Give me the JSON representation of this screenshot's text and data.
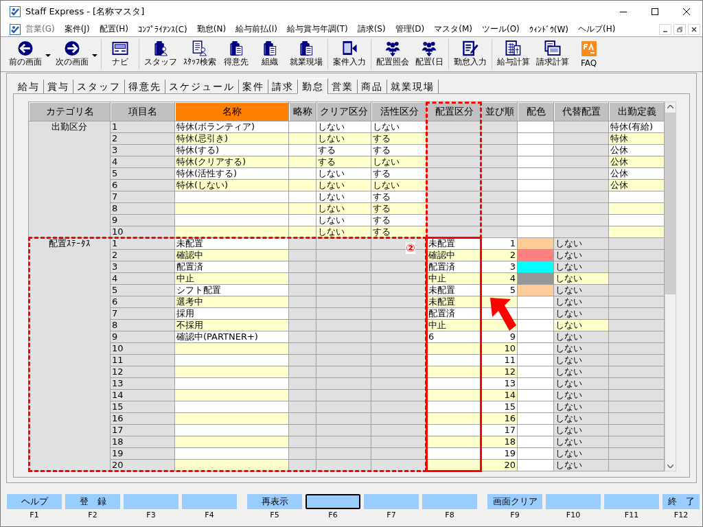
{
  "window": {
    "title": "Staff Express - [名称マスタ]"
  },
  "menu": [
    {
      "label": "営業(G)",
      "disabled": true
    },
    {
      "label": "案件(J)",
      "disabled": false
    },
    {
      "label": "配置(H)",
      "disabled": false
    },
    {
      "label": "ｺﾝﾌﾟﾗｲｱﾝｽ(C)",
      "disabled": false
    },
    {
      "label": "勤怠(N)",
      "disabled": false
    },
    {
      "label": "給与前払(I)",
      "disabled": false
    },
    {
      "label": "給与賞与年調(T)",
      "disabled": false
    },
    {
      "label": "請求(S)",
      "disabled": false
    },
    {
      "label": "管理(D)",
      "disabled": false
    },
    {
      "label": "マスタ(M)",
      "disabled": false
    },
    {
      "label": "ツール(O)",
      "disabled": false
    },
    {
      "label": "ｳｨﾝﾄﾞｳ(W)",
      "disabled": false
    },
    {
      "label": "ヘルプ(H)",
      "disabled": false
    }
  ],
  "toolbar_groups": [
    {
      "items": [
        {
          "label": "前の画面",
          "kind": "back",
          "dropdown": true
        },
        {
          "label": "次の画面",
          "kind": "forward",
          "dropdown": true
        }
      ]
    },
    {
      "items": [
        {
          "label": "ナビ",
          "kind": "panel",
          "dropdown": false
        }
      ]
    },
    {
      "items": [
        {
          "label": "スタッフ",
          "kind": "binder-person",
          "dropdown": false
        },
        {
          "label": "ｽﾀｯﾌ検索",
          "kind": "document-person",
          "dropdown": false
        },
        {
          "label": "得意先",
          "kind": "binder-building",
          "dropdown": false
        },
        {
          "label": "組織",
          "kind": "binder-building",
          "dropdown": false
        },
        {
          "label": "就業現場",
          "kind": "binder-building",
          "dropdown": false
        }
      ]
    },
    {
      "items": [
        {
          "label": "案件入力",
          "kind": "document-arrow",
          "dropdown": false
        }
      ]
    },
    {
      "items": [
        {
          "label": "配置照会",
          "kind": "people",
          "dropdown": false
        },
        {
          "label": "配置(日",
          "kind": "people",
          "dropdown": false
        }
      ]
    },
    {
      "items": [
        {
          "label": "勤怠入力",
          "kind": "pen-document",
          "dropdown": false
        }
      ]
    },
    {
      "items": [
        {
          "label": "給与計算",
          "kind": "calculator",
          "dropdown": false
        },
        {
          "label": "請求計算",
          "kind": "screen",
          "dropdown": false
        },
        {
          "label": "FAQ",
          "kind": "faq",
          "dropdown": false
        }
      ]
    }
  ],
  "tabs": [
    {
      "label": "給与",
      "selected": false
    },
    {
      "label": "賞与",
      "selected": false
    },
    {
      "label": "スタッフ",
      "selected": false
    },
    {
      "label": "得意先",
      "selected": false
    },
    {
      "label": "スケジュール",
      "selected": false
    },
    {
      "label": "案件",
      "selected": false
    },
    {
      "label": "請求",
      "selected": false
    },
    {
      "label": "勤怠",
      "selected": true
    },
    {
      "label": "営業",
      "selected": false
    },
    {
      "label": "商品",
      "selected": false
    },
    {
      "label": "就業現場",
      "selected": false
    }
  ],
  "grid": {
    "columns": [
      {
        "label": "カテゴリ名",
        "sorted": false
      },
      {
        "label": "項目名",
        "sorted": false
      },
      {
        "label": "名称",
        "sorted": true
      },
      {
        "label": "略称",
        "sorted": false
      },
      {
        "label": "クリア区分",
        "sorted": false
      },
      {
        "label": "活性区分",
        "sorted": false
      },
      {
        "label": "配置区分",
        "sorted": false
      },
      {
        "label": "並び順",
        "sorted": false
      },
      {
        "label": "配色",
        "sorted": false
      },
      {
        "label": "代替配置",
        "sorted": false
      },
      {
        "label": "出勤定義",
        "sorted": false
      }
    ],
    "groups": [
      {
        "category": "出勤区分",
        "column_states": [
          {
            "editable": false
          },
          {
            "editable": false
          },
          {
            "editable": true
          },
          {
            "editable": true
          },
          {
            "editable": true
          },
          {
            "editable": true
          },
          {
            "editable": false
          },
          {
            "editable": false
          },
          {
            "editable": true
          },
          {
            "editable": false
          },
          {
            "editable": true
          }
        ],
        "rows": [
          {
            "item": "1",
            "name": "特休(ボランティア)",
            "clear": "しない",
            "active": "しない",
            "definition": "特休(有給)"
          },
          {
            "item": "2",
            "name": "特休(忌引き)",
            "clear": "しない",
            "active": "する",
            "definition": "特休"
          },
          {
            "item": "3",
            "name": "特休(する)",
            "clear": "する",
            "active": "する",
            "definition": "公休"
          },
          {
            "item": "4",
            "name": "特休(クリアする)",
            "clear": "する",
            "active": "しない",
            "definition": "公休"
          },
          {
            "item": "5",
            "name": "特休(活性する)",
            "clear": "しない",
            "active": "する",
            "definition": "公休"
          },
          {
            "item": "6",
            "name": "特休(しない)",
            "clear": "しない",
            "active": "しない",
            "definition": "公休"
          },
          {
            "item": "7",
            "clear": "しない",
            "active": "する"
          },
          {
            "item": "8",
            "clear": "しない",
            "active": "する"
          },
          {
            "item": "9",
            "clear": "しない",
            "active": "する"
          },
          {
            "item": "10",
            "clear": "しない",
            "active": "する"
          }
        ]
      },
      {
        "category": "配置ｽﾃｰﾀｽ",
        "column_states": [
          {
            "editable": false
          },
          {
            "editable": false
          },
          {
            "editable": true
          },
          {
            "editable": false
          },
          {
            "editable": false
          },
          {
            "editable": false
          },
          {
            "editable": true
          },
          {
            "editable": true
          },
          {
            "editable": true
          },
          {
            "editable": false
          },
          {
            "editable": false
          }
        ],
        "rows": [
          {
            "item": "1",
            "name": "未配置",
            "placement": "未配置",
            "order": "1",
            "color": "#ffcc99",
            "alternate": "しない",
            "alternate_editable": false
          },
          {
            "item": "2",
            "name": "確認中",
            "placement": "確認中",
            "order": "2",
            "color": "#ff8080",
            "alternate": "しない",
            "alternate_editable": false
          },
          {
            "item": "3",
            "name": "配置済",
            "placement": "配置済",
            "order": "3",
            "color": "#00ffff",
            "alternate": "しない",
            "alternate_editable": false
          },
          {
            "item": "4",
            "name": "中止",
            "placement": "中止",
            "order": "4",
            "color": "#969696",
            "alternate": "しない",
            "alternate_editable": true
          },
          {
            "item": "5",
            "name": "シフト配置",
            "placement": "未配置",
            "order": "5",
            "color": "#ffcc99",
            "alternate": "しない",
            "alternate_editable": false
          },
          {
            "item": "6",
            "name": "選考中",
            "placement": "未配置",
            "alternate": "しない",
            "alternate_editable": false
          },
          {
            "item": "7",
            "name": "採用",
            "placement": "配置済",
            "alternate": "しない",
            "alternate_editable": false
          },
          {
            "item": "8",
            "name": "不採用",
            "placement": "中止",
            "alternate": "しない",
            "alternate_editable": true
          },
          {
            "item": "9",
            "name": "確認中(PARTNER+)",
            "placement": "6",
            "order": "9",
            "alternate": "しない",
            "alternate_editable": false
          },
          {
            "item": "10",
            "order": "10",
            "alternate": "しない",
            "alternate_editable": false
          },
          {
            "item": "11",
            "order": "11",
            "alternate": "しない",
            "alternate_editable": false
          },
          {
            "item": "12",
            "order": "12",
            "alternate": "しない",
            "alternate_editable": false
          },
          {
            "item": "13",
            "order": "13",
            "alternate": "しない",
            "alternate_editable": false
          },
          {
            "item": "14",
            "order": "14",
            "alternate": "しない",
            "alternate_editable": false
          },
          {
            "item": "15",
            "order": "15",
            "alternate": "しない",
            "alternate_editable": false
          },
          {
            "item": "16",
            "order": "16",
            "alternate": "しない",
            "alternate_editable": false
          },
          {
            "item": "17",
            "order": "17",
            "alternate": "しない",
            "alternate_editable": false
          },
          {
            "item": "18",
            "order": "18",
            "alternate": "しない",
            "alternate_editable": false
          },
          {
            "item": "19",
            "order": "19",
            "alternate": "しない",
            "alternate_editable": false
          },
          {
            "item": "20",
            "order": "20",
            "alternate": "しない",
            "alternate_editable": false
          }
        ]
      }
    ]
  },
  "annotation": {
    "marker": "②"
  },
  "function_key_groups": [
    {
      "keys": [
        {
          "key": "F1",
          "label": "ヘルプ",
          "focused": false
        },
        {
          "key": "F2",
          "label": "登　録",
          "focused": false
        },
        {
          "key": "F3",
          "focused": false
        },
        {
          "key": "F4",
          "focused": false
        }
      ]
    },
    {
      "keys": [
        {
          "key": "F5",
          "label": "再表示",
          "focused": false
        },
        {
          "key": "F6",
          "focused": true
        },
        {
          "key": "F7",
          "focused": false
        },
        {
          "key": "F8",
          "focused": false
        }
      ]
    },
    {
      "keys": [
        {
          "key": "F9",
          "label": "画面クリア",
          "focused": false
        },
        {
          "key": "F10",
          "focused": false
        },
        {
          "key": "F11",
          "focused": false
        },
        {
          "key": "F12",
          "label": "終　了",
          "focused": false
        }
      ]
    }
  ]
}
